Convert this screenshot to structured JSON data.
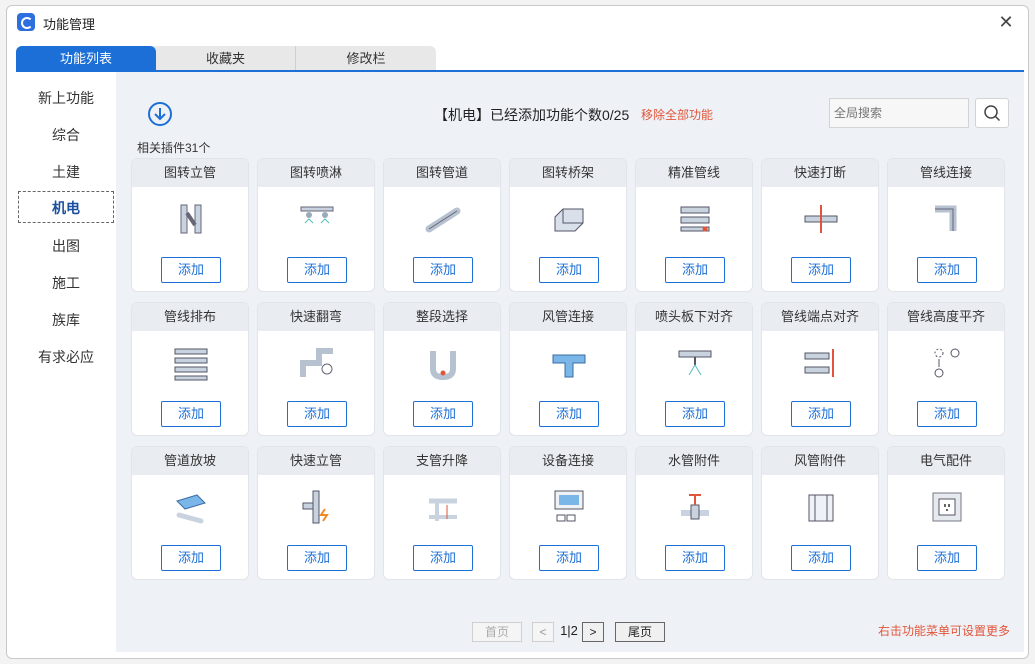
{
  "window": {
    "title": "功能管理"
  },
  "tabs": [
    "功能列表",
    "收藏夹",
    "修改栏"
  ],
  "sidebar": {
    "items": [
      "新上功能",
      "综合",
      "土建",
      "机电",
      "出图",
      "施工",
      "族库",
      "有求必应"
    ],
    "active_index": 3
  },
  "header": {
    "info": "【机电】已经添加功能个数0/25",
    "remove_all": "移除全部功能",
    "search_placeholder": "全局搜索",
    "count": "相关插件31个"
  },
  "cards": [
    {
      "title": "图转立管",
      "icon": "riser-pipe-icon",
      "button": "添加"
    },
    {
      "title": "图转喷淋",
      "icon": "sprinkler-icon",
      "button": "添加"
    },
    {
      "title": "图转管道",
      "icon": "pipe-icon",
      "button": "添加"
    },
    {
      "title": "图转桥架",
      "icon": "cable-tray-icon",
      "button": "添加"
    },
    {
      "title": "精准管线",
      "icon": "precise-pipeline-icon",
      "button": "添加"
    },
    {
      "title": "快速打断",
      "icon": "break-pipe-icon",
      "button": "添加"
    },
    {
      "title": "管线连接",
      "icon": "pipe-connect-icon",
      "button": "添加"
    },
    {
      "title": "管线排布",
      "icon": "pipe-layout-icon",
      "button": "添加"
    },
    {
      "title": "快速翻弯",
      "icon": "pipe-bend-icon",
      "button": "添加"
    },
    {
      "title": "整段选择",
      "icon": "segment-select-icon",
      "button": "添加"
    },
    {
      "title": "风管连接",
      "icon": "duct-connect-icon",
      "button": "添加"
    },
    {
      "title": "喷头板下对齐",
      "icon": "sprinkler-align-icon",
      "button": "添加"
    },
    {
      "title": "管线端点对齐",
      "icon": "endpoint-align-icon",
      "button": "添加"
    },
    {
      "title": "管线高度平齐",
      "icon": "height-align-icon",
      "button": "添加"
    },
    {
      "title": "管道放坡",
      "icon": "pipe-slope-icon",
      "button": "添加"
    },
    {
      "title": "快速立管",
      "icon": "quick-riser-icon",
      "button": "添加"
    },
    {
      "title": "支管升降",
      "icon": "branch-lift-icon",
      "button": "添加"
    },
    {
      "title": "设备连接",
      "icon": "equipment-connect-icon",
      "button": "添加"
    },
    {
      "title": "水管附件",
      "icon": "valve-icon",
      "button": "添加"
    },
    {
      "title": "风管附件",
      "icon": "duct-accessory-icon",
      "button": "添加"
    },
    {
      "title": "电气配件",
      "icon": "socket-icon",
      "button": "添加"
    }
  ],
  "pager": {
    "first": "首页",
    "prev": "<",
    "current": "1|2",
    "next": ">",
    "last": "尾页"
  },
  "footer": {
    "hint": "右击功能菜单可设置更多"
  },
  "colors": {
    "accent": "#1b6fd6",
    "warn": "#e2553a",
    "panel": "#eef2f7"
  }
}
